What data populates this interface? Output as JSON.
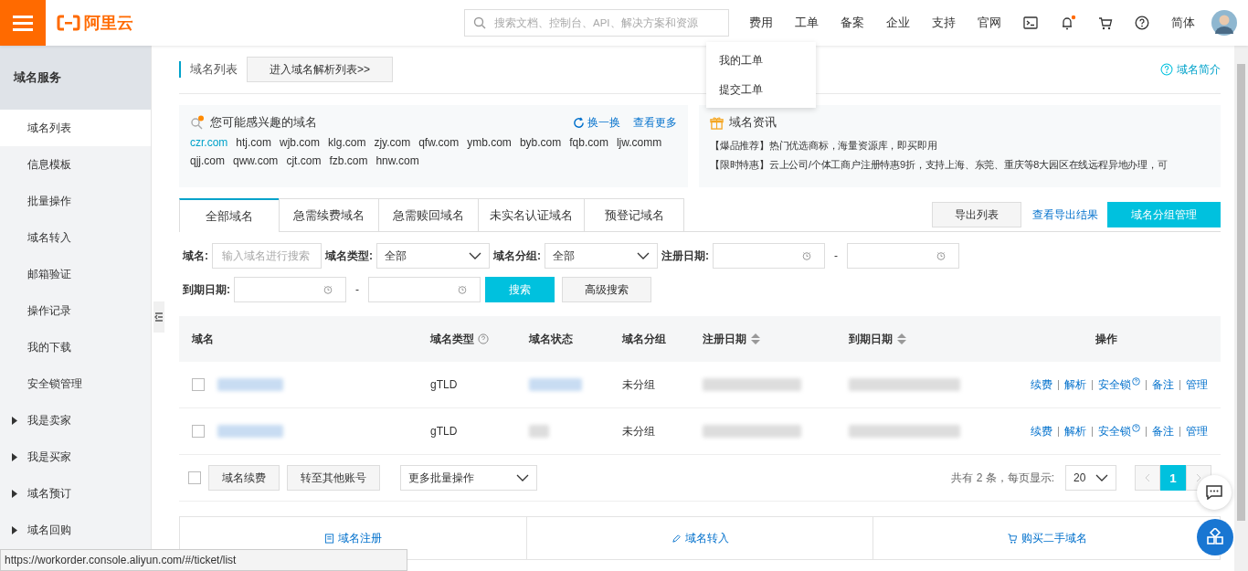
{
  "topbar": {
    "logo": "阿里云",
    "search_placeholder": "搜索文档、控制台、API、解决方案和资源",
    "nav": [
      "费用",
      "工单",
      "备案",
      "企业",
      "支持",
      "官网"
    ],
    "notification_dot": true,
    "language": "简体"
  },
  "dropdown": {
    "items": [
      "我的工单",
      "提交工单"
    ]
  },
  "sidebar": {
    "title": "域名服务",
    "items": [
      {
        "label": "域名列表",
        "kind": "page",
        "selected": true
      },
      {
        "label": "信息模板",
        "kind": "page",
        "selected": false
      },
      {
        "label": "批量操作",
        "kind": "page",
        "selected": false
      },
      {
        "label": "域名转入",
        "kind": "page",
        "selected": false
      },
      {
        "label": "邮箱验证",
        "kind": "page",
        "selected": false
      },
      {
        "label": "操作记录",
        "kind": "page",
        "selected": false
      },
      {
        "label": "我的下载",
        "kind": "page",
        "selected": false
      },
      {
        "label": "安全锁管理",
        "kind": "page",
        "selected": false
      },
      {
        "label": "我是卖家",
        "kind": "group",
        "selected": false
      },
      {
        "label": "我是买家",
        "kind": "group",
        "selected": false
      },
      {
        "label": "域名预订",
        "kind": "group",
        "selected": false
      },
      {
        "label": "域名回购",
        "kind": "group",
        "selected": false
      }
    ]
  },
  "header": {
    "title": "域名列表",
    "button": "进入域名解析列表>>",
    "help_link": "域名简介"
  },
  "suggest_card": {
    "title": "您可能感兴趣的域名",
    "refresh": "换一换",
    "more": "查看更多",
    "domains": [
      {
        "name": "czr.com",
        "selected": true
      },
      {
        "name": "htj.com",
        "selected": false
      },
      {
        "name": "wjb.com",
        "selected": false
      },
      {
        "name": "klg.com",
        "selected": false
      },
      {
        "name": "zjy.com",
        "selected": false
      },
      {
        "name": "qfw.com",
        "selected": false
      },
      {
        "name": "ymb.com",
        "selected": false
      },
      {
        "name": "byb.com",
        "selected": false
      },
      {
        "name": "fqb.com",
        "selected": false
      },
      {
        "name": "ljw.comm",
        "selected": false
      },
      {
        "name": "qjj.com",
        "selected": false
      },
      {
        "name": "qww.com",
        "selected": false
      },
      {
        "name": "cjt.com",
        "selected": false
      },
      {
        "name": "fzb.com",
        "selected": false
      },
      {
        "name": "hnw.com",
        "selected": false
      }
    ]
  },
  "news_card": {
    "title": "域名资讯",
    "lines": [
      "【爆品推荐】热门优选商标，海量资源库，即买即用",
      "【限时特惠】云上公司/个体工商户注册特惠9折，支持上海、东莞、重庆等8大园区在线远程异地办理，可"
    ]
  },
  "tabs": [
    {
      "label": "全部域名",
      "selected": true
    },
    {
      "label": "急需续费域名",
      "selected": false
    },
    {
      "label": "急需赎回域名",
      "selected": false
    },
    {
      "label": "未实名认证域名",
      "selected": false
    },
    {
      "label": "预登记域名",
      "selected": false
    }
  ],
  "tab_actions": {
    "export": "导出列表",
    "view_export": "查看导出结果",
    "group_manage": "域名分组管理"
  },
  "filters": {
    "domain_label": "域名:",
    "domain_placeholder": "输入域名进行搜索",
    "type_label": "域名类型:",
    "type_value": "全部",
    "group_label": "域名分组:",
    "group_value": "全部",
    "reg_label": "注册日期:",
    "exp_label": "到期日期:",
    "range_sep": "-",
    "search": "搜索",
    "advanced": "高级搜索"
  },
  "table": {
    "columns": [
      {
        "label": "域名",
        "kind": "plain"
      },
      {
        "label": "域名类型",
        "kind": "help"
      },
      {
        "label": "域名状态",
        "kind": "plain"
      },
      {
        "label": "域名分组",
        "kind": "plain"
      },
      {
        "label": "注册日期",
        "kind": "sort"
      },
      {
        "label": "到期日期",
        "kind": "sort"
      },
      {
        "label": "操作",
        "kind": "plain"
      }
    ],
    "rows": [
      {
        "checked": false,
        "type": "gTLD",
        "group": "未分组",
        "actions": [
          "续费",
          "解析",
          "安全锁",
          "备注",
          "管理"
        ]
      },
      {
        "checked": false,
        "type": "gTLD",
        "group": "未分组",
        "actions": [
          "续费",
          "解析",
          "安全锁",
          "备注",
          "管理"
        ]
      }
    ]
  },
  "table_footer": {
    "checked": false,
    "buttons": [
      "域名续费",
      "转至其他账号"
    ],
    "batch_select": "更多批量操作",
    "total": "共有 2 条，每页显示:",
    "page_size": "20",
    "pages": [
      {
        "label": "1",
        "selected": true
      }
    ]
  },
  "bottom_links": [
    "域名注册",
    "域名转入",
    "购买二手域名"
  ],
  "status_url": "https://workorder.console.aliyun.com/#/ticket/list"
}
